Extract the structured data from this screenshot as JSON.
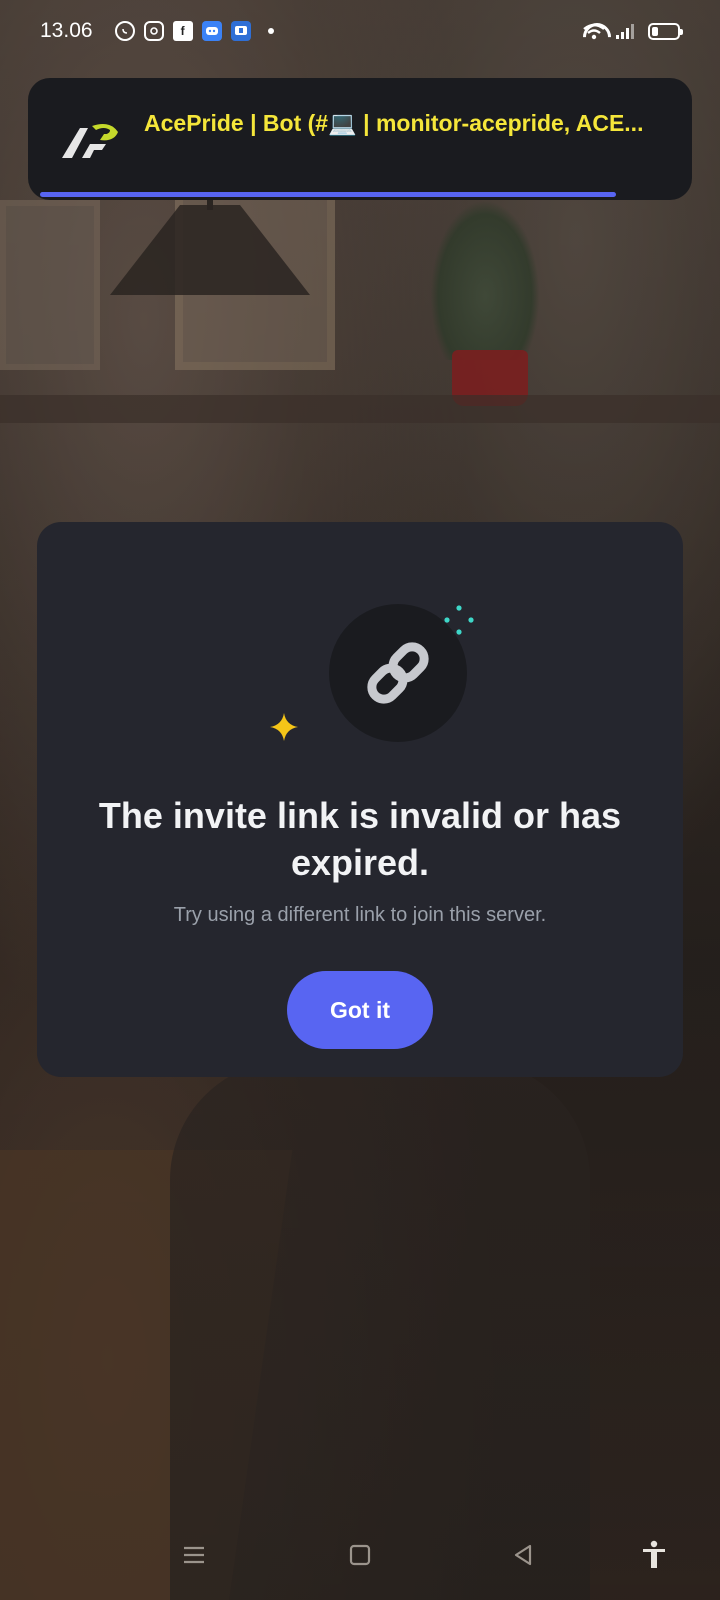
{
  "status_bar": {
    "time": "13.06",
    "app_icons": [
      "whatsapp-icon",
      "instagram-icon",
      "facebook-icon",
      "discord-icon",
      "discord-alt-icon"
    ],
    "battery_level": 0.35
  },
  "notification": {
    "title": "AcePride | Bot (#💻 | monitor-acepride, ACE...",
    "progress": 0.9,
    "colors": {
      "title": "#f5e63a",
      "progress": "#5865f2"
    }
  },
  "dialog": {
    "title": "The invite link is invalid or has expired.",
    "subtitle": "Try using a different link to join this server.",
    "button_label": "Got it",
    "colors": {
      "button": "#5865f2",
      "sparkle_yellow": "#f5c518",
      "sparkle_cyan": "#3ed7c8"
    }
  },
  "nav_bar": {
    "items": [
      "menu-icon",
      "home-icon",
      "back-icon",
      "accessibility-icon"
    ]
  }
}
